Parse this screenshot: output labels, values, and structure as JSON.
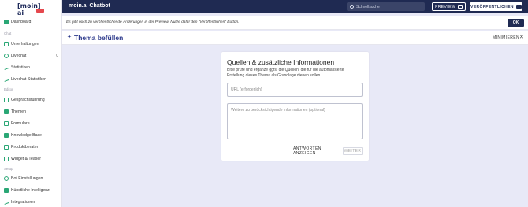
{
  "sidebar": {
    "logo": "[moin] ai",
    "badge_color": "#e5484d",
    "items": [
      {
        "label": "Dashboard",
        "icon": "dashboard-icon"
      },
      {
        "label": "Unterhaltungen",
        "icon": "chat-icon"
      },
      {
        "label": "Livechat",
        "icon": "livechat-icon",
        "count": "0"
      },
      {
        "label": "Statistiken",
        "icon": "chart-icon"
      },
      {
        "label": "Livechat-Statistiken",
        "icon": "chart-icon"
      },
      {
        "label": "Gesprächsführung",
        "icon": "flow-icon"
      },
      {
        "label": "Themen",
        "icon": "topics-icon"
      },
      {
        "label": "Formulare",
        "icon": "form-icon"
      },
      {
        "label": "Knowledge Base",
        "icon": "book-icon"
      },
      {
        "label": "Produktberater",
        "icon": "thumbs-up-icon"
      },
      {
        "label": "Widget & Teaser",
        "icon": "widget-icon"
      },
      {
        "label": "Bot Einstellungen",
        "icon": "settings-icon"
      },
      {
        "label": "Künstliche Intelligenz",
        "icon": "ai-icon"
      },
      {
        "label": "Integrationen",
        "icon": "integrations-icon"
      }
    ],
    "section_labels": [
      "Chat",
      "Editor",
      "Setup"
    ]
  },
  "topbar": {
    "title": "moin.ai Chatbot",
    "search_placeholder": "Schnellsuche",
    "preview_label": "PREVIEW",
    "publish_label": "VERÖFFENTLICHEN",
    "bg_color": "#1f2a52"
  },
  "notice": {
    "text": "Es gibt noch zu veröffentlichende Änderungen in der Preview. Nutze dafür den \"Veröffentlichen\" Button.",
    "ok_label": "OK"
  },
  "panel": {
    "title": "Thema befüllen",
    "minimize_label": "MINIMIEREN",
    "close_glyph": "✕"
  },
  "card": {
    "title": "Quellen & zusätzliche Informationen",
    "description": "Bitte prüfe und ergänze ggfs. die Quellen, die für die automatisierte Erstellung dieses Thema als Grundlage dienen sollen.",
    "url_placeholder": "URL (erforderlich)",
    "info_placeholder": "Weitere zu berücksichtigende Informationen (optional)",
    "answers_label": "ANTWORTEN ANZEIGEN",
    "next_label": "WEITER"
  }
}
